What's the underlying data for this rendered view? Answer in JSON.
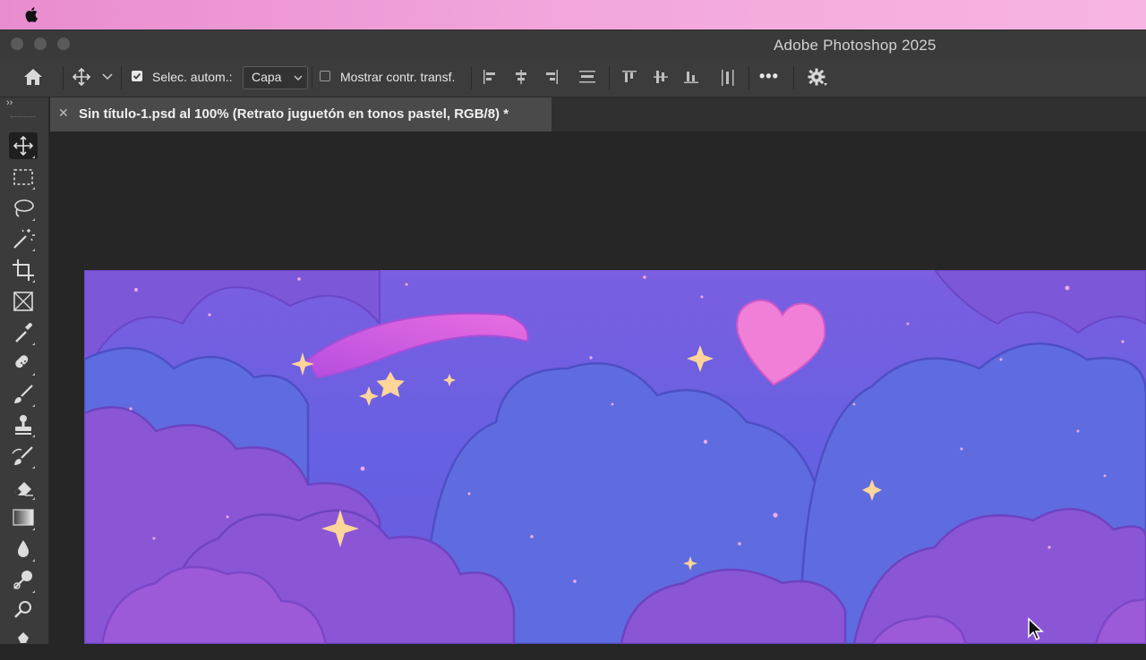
{
  "menubar": {
    "apple_icon": "apple-logo-icon"
  },
  "window": {
    "title": "Adobe Photoshop 2025"
  },
  "options_bar": {
    "auto_select_label": "Selec. autom.:",
    "layer_select_value": "Capa",
    "show_transform_label": "Mostrar contr. transf.",
    "more_label": "•••"
  },
  "document_tab": {
    "title": "Sin título-1.psd al 100% (Retrato juguetón en tonos pastel, RGB/8) *",
    "close_label": "✕"
  },
  "toolbar": {
    "collapse_label": "››",
    "tools": [
      "move-tool",
      "marquee-tool",
      "lasso-tool",
      "magic-wand-tool",
      "crop-tool",
      "frame-tool",
      "eyedropper-tool",
      "healing-brush-tool",
      "brush-tool",
      "clone-stamp-tool",
      "history-brush-tool",
      "eraser-tool",
      "gradient-tool",
      "blur-tool",
      "dodge-tool",
      "pen-tool"
    ]
  },
  "colors": {
    "accent_pink": "#f07fd8",
    "sky_purple": "#6b5be6",
    "cloud_violet": "#8f58d8",
    "star_gold": "#ffd59a"
  }
}
